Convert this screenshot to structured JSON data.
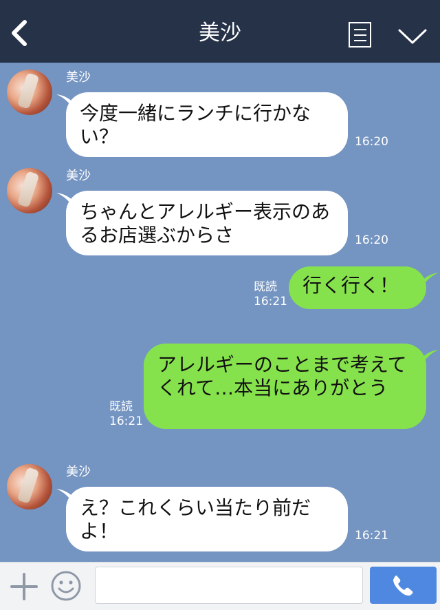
{
  "header": {
    "title": "美沙"
  },
  "messages": [
    {
      "sender": "美沙",
      "text": "今度一緒にランチに行かない？",
      "time": "16:20"
    },
    {
      "sender": "美沙",
      "text": "ちゃんとアレルギー表示のあるお店選ぶからさ",
      "time": "16:20"
    },
    {
      "text": "行く行く！",
      "read": "既読",
      "time": "16:21"
    },
    {
      "text": "アレルギーのことまで考えてくれて…本当にありがとう",
      "read": "既読",
      "time": "16:21"
    },
    {
      "sender": "美沙",
      "text": "え？これくらい当たり前だよ！",
      "time": "16:21"
    }
  ],
  "footer": {
    "input_value": ""
  },
  "colors": {
    "header": "#263248",
    "chat_bg": "#7494c1",
    "outgoing_bubble": "#86e24c",
    "send_button": "#4f88e0"
  }
}
